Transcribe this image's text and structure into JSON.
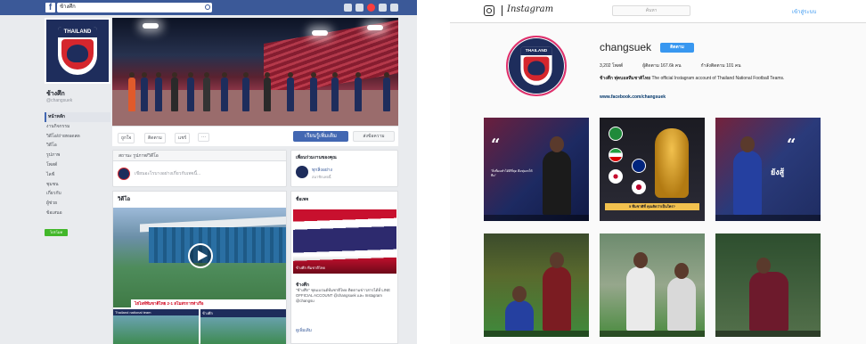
{
  "colors": {
    "facebook_blue": "#3b5998",
    "facebook_button": "#4267b2",
    "facebook_bg": "#e9ebee",
    "instagram_blue": "#3897f0",
    "team_navy": "#1e2d5c",
    "team_red": "#d5262d"
  },
  "facebook": {
    "logo": "f",
    "search_value": "ช้างศึก",
    "profile": {
      "crest_text": "THAILAND",
      "name": "ช้างศึก",
      "handle": "@changsuek"
    },
    "nav": [
      "หน้าหลัก",
      "งานกิจกรรม",
      "วิดีโอ/ถ่ายทอดสด",
      "วิดีโอ",
      "รูปภาพ",
      "โพสต์",
      "ไลฟ์",
      "ชุมชน",
      "เกี่ยวกับ",
      "ผู้ช่วย",
      "ข้อเสนอ"
    ],
    "promote_label": "โปรโมท",
    "actions": {
      "like": "ถูกใจ",
      "follow": "ติดตาม",
      "share": "แชร์",
      "more": "···",
      "cta": "เรียนรู้เพิ่มเติม",
      "message": "ส่งข้อความ"
    },
    "composer": {
      "tabs": "สถานะ  รูปภาพ/วิดีโอ",
      "placeholder": "เขียนอะไรบางอย่างเกี่ยวกับเพจนี้..."
    },
    "videos": {
      "title": "วิดีโอ",
      "caption": "ไฮไลท์ทีมชาติไทย 2-1 สโมสรการท่าเรือ",
      "thumb1_label": "Thailand national team",
      "thumb2_label": "ช้างศึก"
    },
    "side_box": {
      "title": "เพื่อนร่วมงานของคุณ",
      "name": "ทุกสิ่งอย่าง",
      "sub": "สมาชิกเพจนี้"
    },
    "side_post": {
      "title": "ชื่อเพจ",
      "image_caption": "ช้างศึก ทีมชาติไทย",
      "post_title": "ช้างศึก",
      "post_body": "\"ช้างศึก\" ชุดแบรนด์ทีมชาติไทย ติดตามข่าวสารได้ที่ LINE OFFICIAL ACCOUNT @changsuek และ Instagram @changsu",
      "more": "ดูเพิ่มเติม"
    }
  },
  "instagram": {
    "wordmark": "Instagram",
    "search_placeholder": "ค้นหา",
    "login_label": "เข้าสู่ระบบ",
    "username": "changsuek",
    "follow_label": "ติดตาม",
    "stats": {
      "posts": "3,202 โพสต์",
      "followers": "ผู้ติดตาม 167.6k คน",
      "following": "กำลังติดตาม 101 คน"
    },
    "bio_name": "ช้างศึก ฟุตบอลทีมชาติไทย",
    "bio_text": "The official Instagram account of Thailand National Football Teams.",
    "link": "www.facebook.com/changsuek",
    "posts": [
      {
        "type": "quote",
        "caption": "\"สิ่งที่ผมทำได้ดีที่สุด คือทุ่มเทให้ทีม\""
      },
      {
        "type": "world-cup",
        "caption": "5 ทีมชาติที่ คุณคิดว่าเป็นใคร?"
      },
      {
        "type": "quote",
        "caption": "ยังสู้"
      },
      {
        "type": "photo"
      },
      {
        "type": "photo"
      },
      {
        "type": "photo"
      }
    ]
  }
}
